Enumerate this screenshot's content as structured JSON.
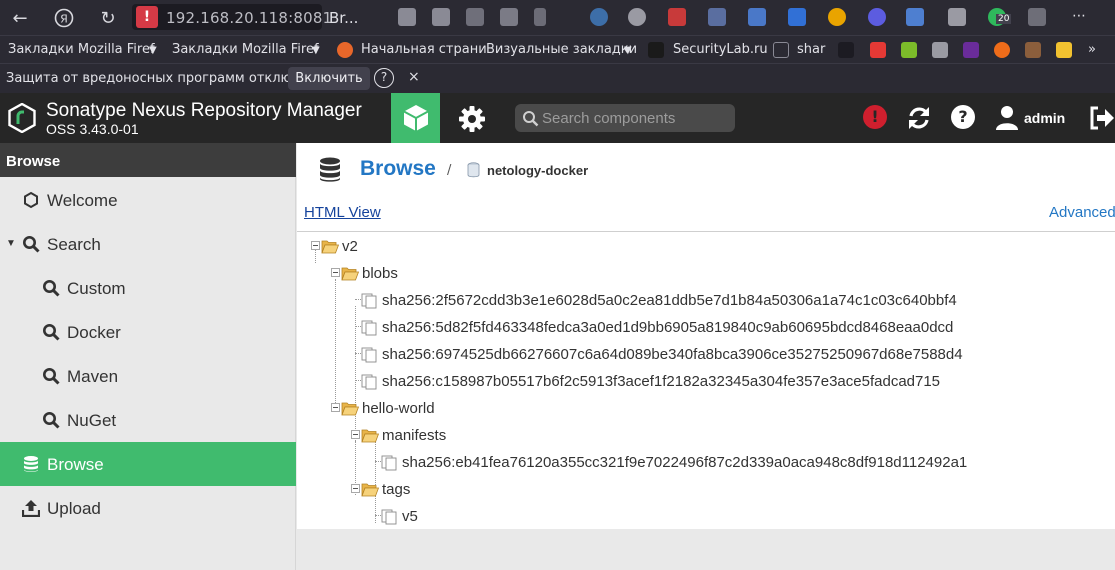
{
  "browser": {
    "url": "192.168.20.118:8081",
    "tab_title": "Br...",
    "ext_badge_count": "20"
  },
  "bookmarks": [
    {
      "label": "Закладки Mozilla Firef"
    },
    {
      "label": "Закладки Mozilla Firef"
    },
    {
      "label": "Начальная страни"
    },
    {
      "label": "Визуальные закладки"
    },
    {
      "label": "SecurityLab.ru"
    },
    {
      "label": "shar"
    }
  ],
  "notification": {
    "text": "Защита от вредоносных программ отключена",
    "enable_button": "Включить",
    "help": "?",
    "close": "×"
  },
  "header": {
    "app_title": "Sonatype Nexus Repository Manager",
    "version": "OSS 3.43.0-01",
    "search_placeholder": "Search components",
    "alert_glyph": "!",
    "help_glyph": "?",
    "user": "admin"
  },
  "sidebar": {
    "title": "Browse",
    "items": [
      {
        "label": "Welcome",
        "icon": "hexagon-icon"
      },
      {
        "label": "Search",
        "icon": "search-icon"
      },
      {
        "label": "Custom",
        "icon": "search-icon"
      },
      {
        "label": "Docker",
        "icon": "search-icon"
      },
      {
        "label": "Maven",
        "icon": "search-icon"
      },
      {
        "label": "NuGet",
        "icon": "search-icon"
      },
      {
        "label": "Browse",
        "icon": "database-icon",
        "active": true
      },
      {
        "label": "Upload",
        "icon": "upload-icon"
      }
    ]
  },
  "breadcrumb": {
    "root": "Browse",
    "separator": "/",
    "repository": "netology-docker"
  },
  "content": {
    "html_view_link": "HTML View",
    "advanced_link": "Advanced",
    "tree": [
      {
        "label": "v2",
        "type": "folder"
      },
      {
        "label": "blobs",
        "type": "folder"
      },
      {
        "label": "sha256:2f5672cdd3b3e1e6028d5a0c2ea81ddb5e7d1b84a50306a1a74c1c03c640bbf4",
        "type": "file"
      },
      {
        "label": "sha256:5d82f5fd463348fedca3a0ed1d9bb6905a819840c9ab60695bdcd8468eaa0dcd",
        "type": "file"
      },
      {
        "label": "sha256:6974525db66276607c6a64d089be340fa8bca3906ce35275250967d68e7588d4",
        "type": "file"
      },
      {
        "label": "sha256:c158987b05517b6f2c5913f3acef1f2182a32345a304fe357e3ace5fadcad715",
        "type": "file"
      },
      {
        "label": "hello-world",
        "type": "folder"
      },
      {
        "label": "manifests",
        "type": "folder"
      },
      {
        "label": "sha256:eb41fea76120a355cc321f9e7022496f87c2d339a0aca948c8df918d112492a1",
        "type": "file"
      },
      {
        "label": "tags",
        "type": "folder"
      },
      {
        "label": "v5",
        "type": "file"
      }
    ]
  },
  "colors": {
    "accent_green": "#40bb6e",
    "header_dark": "#262626",
    "link_blue": "#2377c4"
  }
}
